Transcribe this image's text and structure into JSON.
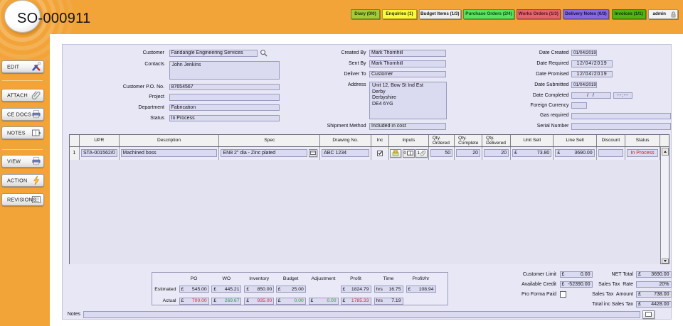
{
  "colors": {
    "brand_orange": "#F2A438",
    "status_red": "#CC2222",
    "negative_red": "#D92B35",
    "positive_green": "#2E9E44"
  },
  "header": {
    "title": "SO-000911",
    "nav": [
      {
        "label": "Diary (0/0)",
        "bg": "#A4CB35",
        "fg": "#273500"
      },
      {
        "label": "Enquiries (1)",
        "bg": "#FBF73B",
        "fg": "#33330a"
      },
      {
        "label": "Budget Items (1/3)",
        "bg": "#F0EEEC",
        "fg": "#1a1a1a"
      },
      {
        "label": "Purchase Orders (2/4)",
        "bg": "#58E55C",
        "fg": "#0d4d12"
      },
      {
        "label": "Works Orders (1/3)",
        "bg": "#E5646C",
        "fg": "#5d0f18"
      },
      {
        "label": "Delivery Notes (0/3)",
        "bg": "#8768E2",
        "fg": "#161042"
      },
      {
        "label": "Invoices (1/1)",
        "bg": "#53B411",
        "fg": "#0f3300"
      },
      {
        "label": "admin",
        "bg": "#F4F2F0",
        "fg": "#1a1a1a"
      }
    ]
  },
  "sidebar": {
    "buttons": [
      {
        "label": "EDIT"
      },
      {
        "label": "ATTACH"
      },
      {
        "label": "CE DOCS"
      },
      {
        "label": "NOTES"
      },
      {
        "label": "VIEW"
      },
      {
        "label": "ACTION"
      },
      {
        "label": "REVISIONS"
      }
    ]
  },
  "form": {
    "customer": {
      "label": "Customer",
      "value": "Fandangle Engineering Services"
    },
    "contacts": {
      "label": "Contacts",
      "value": "John Jenkins"
    },
    "customer_po_no": {
      "label": "Customer P.O. No.",
      "value": "87654567"
    },
    "project": {
      "label": "Project",
      "value": ""
    },
    "department": {
      "label": "Department",
      "value": "Fabrication"
    },
    "status": {
      "label": "Status",
      "value": "In Process"
    },
    "created_by": {
      "label": "Created By",
      "value": "Mark Thornhill"
    },
    "sent_by": {
      "label": "Sent By",
      "value": "Mark Thornhill"
    },
    "deliver_to": {
      "label": "Deliver To",
      "value": "Customer"
    },
    "address": {
      "label": "Address",
      "value": "Unit 12, Bow St Ind Est\nDerby\nDerbyshire\nDE4 6YG"
    },
    "shipment_method": {
      "label": "Shipment Method",
      "value": "Included in cost"
    },
    "date_created": {
      "label": "Date Created",
      "value": "01/04/2019"
    },
    "date_required": {
      "label": "Date Required",
      "value": "12/04/2019"
    },
    "date_promised": {
      "label": "Date Promised",
      "value": "12/04/2019"
    },
    "date_submitted": {
      "label": "Date Submitted",
      "value": "01/04/2019"
    },
    "date_completed": {
      "label": "Date Completed",
      "value": "/  /",
      "time_value": "--:--"
    },
    "foreign_currency": {
      "label": "Foreign Currency",
      "value": ""
    },
    "gas_required": {
      "label": "Gas required",
      "value": ""
    },
    "serial_number": {
      "label": "Serial Number",
      "value": ""
    }
  },
  "items": {
    "columns": {
      "upr": "UPR",
      "description": "Description",
      "spec": "Spec",
      "drawing_no": "Drawing No.",
      "inc": "Inc",
      "inputs": "Inputs",
      "qty_ordered_1": "Qty.",
      "qty_ordered_2": "Ordered",
      "qty_complete_1": "Qty.",
      "qty_complete_2": "Complete",
      "qty_delivered_1": "Qty.",
      "qty_delivered_2": "Delivered",
      "unit_sell": "Unit Sell",
      "line_sell": "Line Sell",
      "discount": "Discount",
      "status": "Status"
    },
    "row": {
      "num": "1",
      "upr": "STA-001562/0",
      "description": "Machined boss",
      "spec": "EN8 2\" dia - Zinc plated",
      "drawing_no": "ABC 1234",
      "inc_checked": true,
      "inputs_book_count": "0",
      "inputs_clip_count": "1",
      "qty_ordered": "50",
      "qty_complete": "20",
      "qty_delivered": "20",
      "currency": "£",
      "unit_sell": "73.80",
      "line_sell": "3690.00",
      "discount": "",
      "status": "In Process"
    }
  },
  "summary": {
    "currency": "£",
    "time_unit": "hrs",
    "columns": {
      "po": "PO",
      "wo": "WO",
      "inventory": "Inventory",
      "budget": "Budget",
      "adjustment": "Adjustment",
      "profit": "Profit",
      "time": "Time",
      "profit_hr": "Profit/hr"
    },
    "estimated": {
      "label": "Estimated",
      "po": "545.00",
      "wo": "445.21",
      "inventory": "850.00",
      "budget": "25.00",
      "profit": "1824.79",
      "time": "16.75",
      "profit_hr": "108.94"
    },
    "actual": {
      "label": "Actual",
      "po": "700.00",
      "wo": "269.67",
      "inventory": "935.00",
      "budget": "0.00",
      "adjustment": "0.00",
      "profit": "1785.33",
      "time": "7.19"
    }
  },
  "totals": {
    "currency": "£",
    "customer_limit": {
      "label": "Customer Limit",
      "value": "0.00"
    },
    "available_credit": {
      "label": "Available Credit",
      "value": "-52390.00"
    },
    "pro_forma_paid": {
      "label": "Pro Forma Paid",
      "checked": false
    },
    "net_total": {
      "label": "NET Total",
      "value": "3690.00"
    },
    "sales_tax_rate": {
      "label": "Sales Tax  Rate",
      "value": "20%"
    },
    "sales_tax_amount": {
      "label": "Sales Tax  Amount",
      "value": "738.00"
    },
    "total_inc_sales_tax": {
      "label": "Total inc Sales Tax",
      "value": "4428.00"
    }
  },
  "notes": {
    "label": "Notes",
    "value": ""
  }
}
